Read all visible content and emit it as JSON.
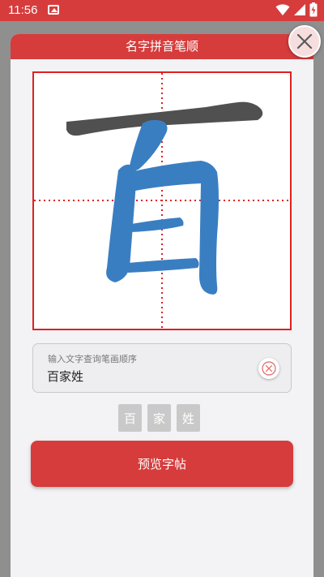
{
  "status_bar": {
    "time": "11:56",
    "icons": [
      "image-icon",
      "wifi-icon",
      "signal-icon",
      "battery-icon"
    ]
  },
  "dialog": {
    "title": "名字拼音笔顺",
    "close_icon": "close-icon"
  },
  "stroke_display": {
    "character": "百",
    "guide_color": "#e02020",
    "completed_stroke_color": "#505050",
    "current_stroke_color": "#3a7ec2"
  },
  "search": {
    "label": "输入文字查询笔画顺序",
    "value": "百家姓",
    "clear_icon": "clear-icon"
  },
  "characters": [
    "百",
    "家",
    "姓"
  ],
  "preview_button": {
    "label": "预览字帖"
  },
  "colors": {
    "accent": "#d63c3c",
    "tile_bg": "#c9c9c9"
  }
}
